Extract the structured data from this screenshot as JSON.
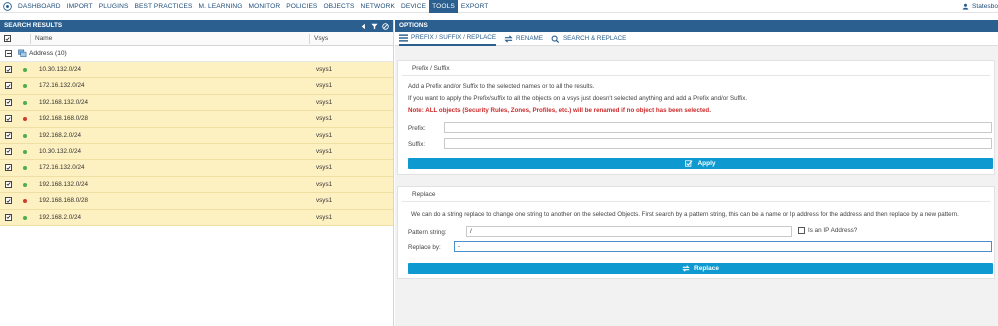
{
  "nav": {
    "items": [
      "DASHBOARD",
      "IMPORT",
      "PLUGINS",
      "BEST PRACTICES",
      "M. LEARNING",
      "MONITOR",
      "POLICIES",
      "OBJECTS",
      "NETWORK",
      "DEVICE",
      "TOOLS",
      "EXPORT"
    ],
    "active": "TOOLS",
    "user": "Statesbo",
    "logo_icon": "expedition-logo-icon",
    "user_icon": "user-icon"
  },
  "search_results": {
    "title": "SEARCH RESULTS",
    "columns": {
      "name": "Name",
      "vsys": "Vsys"
    },
    "group": {
      "label": "Address (10)"
    },
    "rows": [
      {
        "name": "10.30.132.0/24",
        "vsys": "vsys1",
        "status": "green"
      },
      {
        "name": "172.16.132.0/24",
        "vsys": "vsys1",
        "status": "green"
      },
      {
        "name": "192.168.132.0/24",
        "vsys": "vsys1",
        "status": "green"
      },
      {
        "name": "192.168.168.0/28",
        "vsys": "vsys1",
        "status": "red"
      },
      {
        "name": "192.168.2.0/24",
        "vsys": "vsys1",
        "status": "green"
      },
      {
        "name": "10.30.132.0/24",
        "vsys": "vsys1",
        "status": "green"
      },
      {
        "name": "172.16.132.0/24",
        "vsys": "vsys1",
        "status": "green"
      },
      {
        "name": "192.168.132.0/24",
        "vsys": "vsys1",
        "status": "green"
      },
      {
        "name": "192.168.168.0/28",
        "vsys": "vsys1",
        "status": "red"
      },
      {
        "name": "192.168.2.0/24",
        "vsys": "vsys1",
        "status": "green"
      }
    ]
  },
  "options": {
    "title": "OPTIONS",
    "tabs": [
      {
        "label": "PREFIX / SUFFIX / REPLACE",
        "icon": "list-icon"
      },
      {
        "label": "RENAME",
        "icon": "swap-icon"
      },
      {
        "label": "SEARCH & REPLACE",
        "icon": "search-icon"
      }
    ],
    "prefix_suffix": {
      "title": "Prefix / Suffix",
      "line1": "Add a Prefix and/or Suffix to the selected names or to all the results.",
      "line2": "If you want to apply the Prefix/suffix to all the objects on a vsys just doesn't selected anything and add a Prefix and/or Suffix.",
      "note": "Note: ALL objects (Security Rules, Zones, Profiles, etc.) will be renamed if no object has been selected.",
      "prefix_label": "Prefix:",
      "suffix_label": "Suffix:",
      "prefix_value": "",
      "suffix_value": "",
      "apply_label": "Apply"
    },
    "replace": {
      "title": "Replace",
      "description": "We can do a string replace to change one string to another on the selected Objects. First search by a pattern string, this can be a name or Ip address for the address and then replace by a new pattern.",
      "pattern_label": "Pattern string:",
      "pattern_value": "/",
      "ip_label": "Is an IP Address?",
      "replace_label": "Replace by:",
      "replace_value": "-",
      "button_label": "Replace"
    }
  },
  "colors": {
    "nav_blue": "#2b5f8f",
    "row_yellow": "#fdf0c1",
    "button_blue": "#0e9ad1",
    "status_green": "#4cae4c",
    "status_red": "#d23b2b",
    "warn_red": "#cc2b2b"
  }
}
